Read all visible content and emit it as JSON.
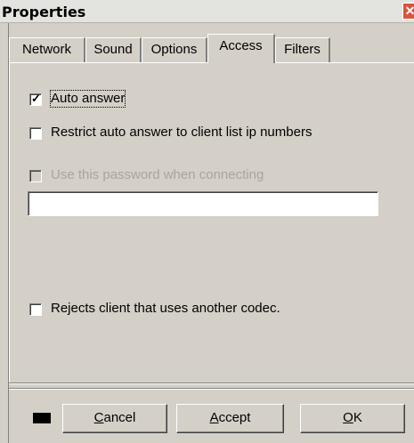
{
  "window": {
    "title": "Properties",
    "close_glyph": "✕"
  },
  "tabs": [
    {
      "label": "Network"
    },
    {
      "label": "Sound"
    },
    {
      "label": "Options"
    },
    {
      "label": "Access",
      "active": true
    },
    {
      "label": "Filters"
    }
  ],
  "access": {
    "auto_answer": {
      "label": "Auto answer",
      "checked": true
    },
    "restrict": {
      "label": "Restrict auto answer to client list ip numbers",
      "checked": false
    },
    "use_password": {
      "label": "Use this password when connecting",
      "checked": false,
      "enabled": false
    },
    "password_value": "",
    "reject_codec": {
      "label": "Rejects client that uses another codec.",
      "checked": false
    }
  },
  "footer": {
    "color_swatch": "#000000",
    "cancel": {
      "accel": "C",
      "rest": "ancel"
    },
    "accept": {
      "accel": "A",
      "rest": "ccept"
    },
    "ok": {
      "accel": "O",
      "rest": "K"
    }
  },
  "colors": {
    "face": "#d4d0c8",
    "close": "#d8553b",
    "disabled_text": "#a8a59d"
  }
}
